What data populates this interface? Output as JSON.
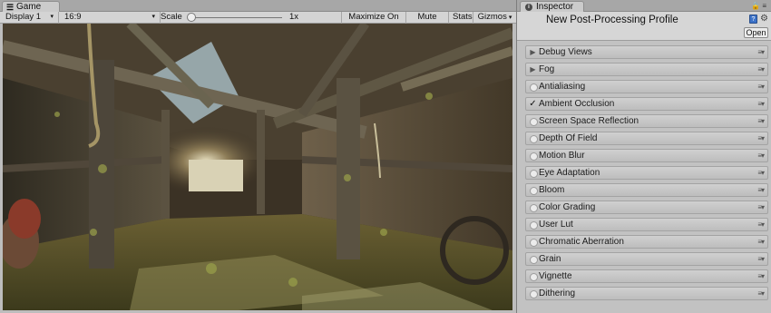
{
  "game": {
    "tab_label": "Game",
    "display": "Display 1",
    "aspect": "16:9",
    "scale_label": "Scale",
    "scale_value": 0.0,
    "zoom": "1x",
    "buttons": {
      "maximize": "Maximize On Play",
      "mute": "Mute Audio",
      "stats": "Stats",
      "gizmos": "Gizmos"
    },
    "view_icon": "game-controller-icon",
    "scene": "Scene viewport: rendered interior of wooden barn"
  },
  "inspector": {
    "tab_label": "Inspector",
    "profile_title": "New Post-Processing Profile",
    "open_button": "Open",
    "effects": [
      {
        "label": "Debug Views",
        "state": "collapsed"
      },
      {
        "label": "Fog",
        "state": "collapsed"
      },
      {
        "label": "Antialiasing",
        "state": "off"
      },
      {
        "label": "Ambient Occlusion",
        "state": "on"
      },
      {
        "label": "Screen Space Reflection",
        "state": "off"
      },
      {
        "label": "Depth Of Field",
        "state": "off"
      },
      {
        "label": "Motion Blur",
        "state": "off"
      },
      {
        "label": "Eye Adaptation",
        "state": "off"
      },
      {
        "label": "Bloom",
        "state": "off"
      },
      {
        "label": "Color Grading",
        "state": "off"
      },
      {
        "label": "User Lut",
        "state": "off"
      },
      {
        "label": "Chromatic Aberration",
        "state": "off"
      },
      {
        "label": "Grain",
        "state": "off"
      },
      {
        "label": "Vignette",
        "state": "off"
      },
      {
        "label": "Dithering",
        "state": "off"
      }
    ]
  },
  "colors": {
    "panel_bg": "#c2c2c2",
    "toolbar_bg": "#d4d4d4",
    "accent": "#3d73c9"
  }
}
